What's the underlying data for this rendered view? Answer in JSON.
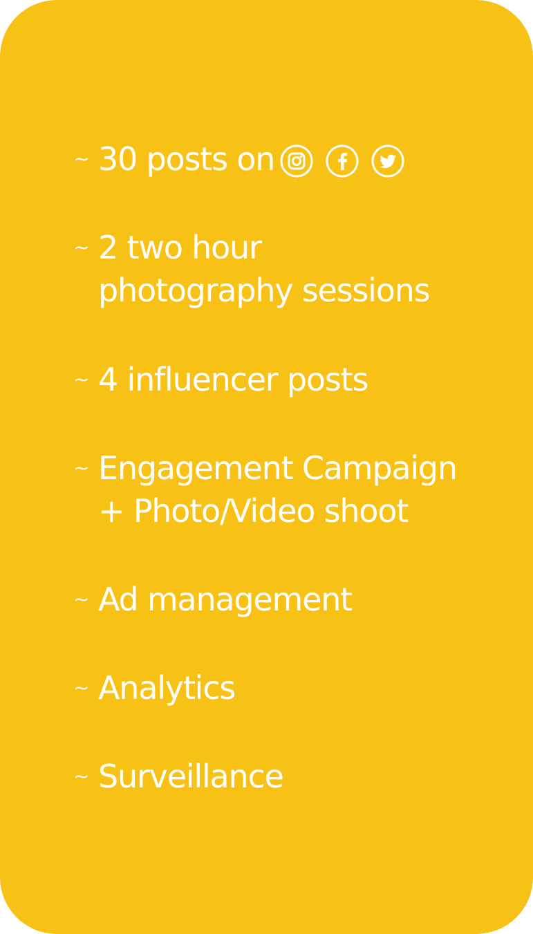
{
  "colors": {
    "card_background": "#f7c116",
    "text": "#ffffff"
  },
  "bullet": "~",
  "items": [
    {
      "lines": [
        "30 posts on"
      ]
    },
    {
      "lines": [
        "2 two hour",
        "photography sessions"
      ]
    },
    {
      "lines": [
        "4 influencer posts"
      ]
    },
    {
      "lines": [
        "Engagement Campaign",
        "+ Photo/Video shoot"
      ]
    },
    {
      "lines": [
        "Ad management"
      ]
    },
    {
      "lines": [
        "Analytics"
      ]
    },
    {
      "lines": [
        "Surveillance"
      ]
    }
  ],
  "social_icons": [
    "instagram-icon",
    "facebook-icon",
    "twitter-icon"
  ]
}
